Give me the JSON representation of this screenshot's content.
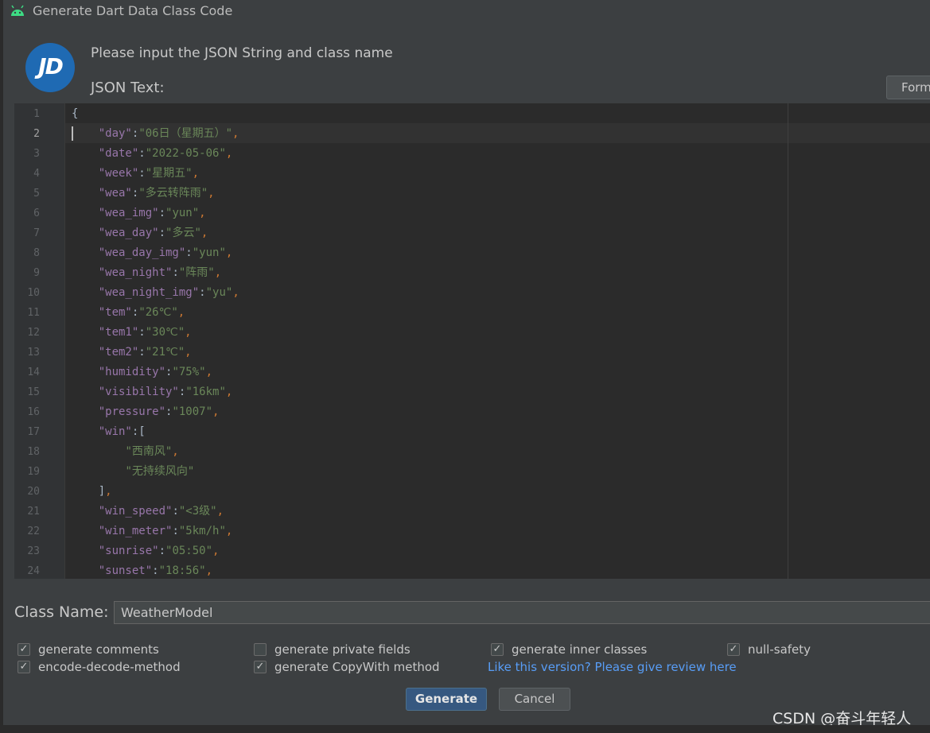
{
  "window": {
    "title": "Generate Dart Data Class Code",
    "icon": "android-icon"
  },
  "logo": {
    "text": "JD",
    "color": "#1f6ab3",
    "icon": "jd-logo"
  },
  "prompt": "Please input the JSON String and class name",
  "json_label": "JSON Text:",
  "format_button": "Form",
  "editor": {
    "current_line": 2,
    "lines": [
      {
        "n": "1",
        "parts": [
          [
            "b",
            "{"
          ]
        ]
      },
      {
        "n": "2",
        "parts": [
          [
            "b",
            "    "
          ],
          [
            "k",
            "\"day\""
          ],
          [
            "b",
            ":"
          ],
          [
            "s",
            "\"06日（星期五）\""
          ],
          [
            "p",
            ","
          ]
        ]
      },
      {
        "n": "3",
        "parts": [
          [
            "b",
            "    "
          ],
          [
            "k",
            "\"date\""
          ],
          [
            "b",
            ":"
          ],
          [
            "s",
            "\"2022-05-06\""
          ],
          [
            "p",
            ","
          ]
        ]
      },
      {
        "n": "4",
        "parts": [
          [
            "b",
            "    "
          ],
          [
            "k",
            "\"week\""
          ],
          [
            "b",
            ":"
          ],
          [
            "s",
            "\"星期五\""
          ],
          [
            "p",
            ","
          ]
        ]
      },
      {
        "n": "5",
        "parts": [
          [
            "b",
            "    "
          ],
          [
            "k",
            "\"wea\""
          ],
          [
            "b",
            ":"
          ],
          [
            "s",
            "\"多云转阵雨\""
          ],
          [
            "p",
            ","
          ]
        ]
      },
      {
        "n": "6",
        "parts": [
          [
            "b",
            "    "
          ],
          [
            "k",
            "\"wea_img\""
          ],
          [
            "b",
            ":"
          ],
          [
            "s",
            "\"yun\""
          ],
          [
            "p",
            ","
          ]
        ]
      },
      {
        "n": "7",
        "parts": [
          [
            "b",
            "    "
          ],
          [
            "k",
            "\"wea_day\""
          ],
          [
            "b",
            ":"
          ],
          [
            "s",
            "\"多云\""
          ],
          [
            "p",
            ","
          ]
        ]
      },
      {
        "n": "8",
        "parts": [
          [
            "b",
            "    "
          ],
          [
            "k",
            "\"wea_day_img\""
          ],
          [
            "b",
            ":"
          ],
          [
            "s",
            "\"yun\""
          ],
          [
            "p",
            ","
          ]
        ]
      },
      {
        "n": "9",
        "parts": [
          [
            "b",
            "    "
          ],
          [
            "k",
            "\"wea_night\""
          ],
          [
            "b",
            ":"
          ],
          [
            "s",
            "\"阵雨\""
          ],
          [
            "p",
            ","
          ]
        ]
      },
      {
        "n": "10",
        "parts": [
          [
            "b",
            "    "
          ],
          [
            "k",
            "\"wea_night_img\""
          ],
          [
            "b",
            ":"
          ],
          [
            "s",
            "\"yu\""
          ],
          [
            "p",
            ","
          ]
        ]
      },
      {
        "n": "11",
        "parts": [
          [
            "b",
            "    "
          ],
          [
            "k",
            "\"tem\""
          ],
          [
            "b",
            ":"
          ],
          [
            "s",
            "\"26℃\""
          ],
          [
            "p",
            ","
          ]
        ]
      },
      {
        "n": "12",
        "parts": [
          [
            "b",
            "    "
          ],
          [
            "k",
            "\"tem1\""
          ],
          [
            "b",
            ":"
          ],
          [
            "s",
            "\"30℃\""
          ],
          [
            "p",
            ","
          ]
        ]
      },
      {
        "n": "13",
        "parts": [
          [
            "b",
            "    "
          ],
          [
            "k",
            "\"tem2\""
          ],
          [
            "b",
            ":"
          ],
          [
            "s",
            "\"21℃\""
          ],
          [
            "p",
            ","
          ]
        ]
      },
      {
        "n": "14",
        "parts": [
          [
            "b",
            "    "
          ],
          [
            "k",
            "\"humidity\""
          ],
          [
            "b",
            ":"
          ],
          [
            "s",
            "\"75%\""
          ],
          [
            "p",
            ","
          ]
        ]
      },
      {
        "n": "15",
        "parts": [
          [
            "b",
            "    "
          ],
          [
            "k",
            "\"visibility\""
          ],
          [
            "b",
            ":"
          ],
          [
            "s",
            "\"16km\""
          ],
          [
            "p",
            ","
          ]
        ]
      },
      {
        "n": "16",
        "parts": [
          [
            "b",
            "    "
          ],
          [
            "k",
            "\"pressure\""
          ],
          [
            "b",
            ":"
          ],
          [
            "s",
            "\"1007\""
          ],
          [
            "p",
            ","
          ]
        ]
      },
      {
        "n": "17",
        "parts": [
          [
            "b",
            "    "
          ],
          [
            "k",
            "\"win\""
          ],
          [
            "b",
            ":["
          ]
        ]
      },
      {
        "n": "18",
        "parts": [
          [
            "b",
            "        "
          ],
          [
            "s",
            "\"西南风\""
          ],
          [
            "p",
            ","
          ]
        ]
      },
      {
        "n": "19",
        "parts": [
          [
            "b",
            "        "
          ],
          [
            "s",
            "\"无持续风向\""
          ]
        ]
      },
      {
        "n": "20",
        "parts": [
          [
            "b",
            "    ]"
          ],
          [
            "p",
            ","
          ]
        ]
      },
      {
        "n": "21",
        "parts": [
          [
            "b",
            "    "
          ],
          [
            "k",
            "\"win_speed\""
          ],
          [
            "b",
            ":"
          ],
          [
            "s",
            "\"<3级\""
          ],
          [
            "p",
            ","
          ]
        ]
      },
      {
        "n": "22",
        "parts": [
          [
            "b",
            "    "
          ],
          [
            "k",
            "\"win_meter\""
          ],
          [
            "b",
            ":"
          ],
          [
            "s",
            "\"5km/h\""
          ],
          [
            "p",
            ","
          ]
        ]
      },
      {
        "n": "23",
        "parts": [
          [
            "b",
            "    "
          ],
          [
            "k",
            "\"sunrise\""
          ],
          [
            "b",
            ":"
          ],
          [
            "s",
            "\"05:50\""
          ],
          [
            "p",
            ","
          ]
        ]
      },
      {
        "n": "24",
        "parts": [
          [
            "b",
            "    "
          ],
          [
            "k",
            "\"sunset\""
          ],
          [
            "b",
            ":"
          ],
          [
            "s",
            "\"18:56\""
          ],
          [
            "p",
            ","
          ]
        ]
      }
    ]
  },
  "class_name": {
    "label": "Class Name:",
    "value": "WeatherModel"
  },
  "options": [
    {
      "id": "generate-comments",
      "label": "generate comments",
      "checked": true
    },
    {
      "id": "generate-private-fields",
      "label": "generate private fields",
      "checked": false
    },
    {
      "id": "generate-inner-classes",
      "label": "generate inner classes",
      "checked": true
    },
    {
      "id": "null-safety",
      "label": "null-safety",
      "checked": true
    },
    {
      "id": "encode-decode-method",
      "label": "encode-decode-method",
      "checked": true
    },
    {
      "id": "generate-copywith-method",
      "label": "generate CopyWith method",
      "checked": true
    }
  ],
  "review_link": "Like this version? Please give review here",
  "buttons": {
    "generate": "Generate",
    "cancel": "Cancel"
  },
  "watermark": "CSDN @奋斗年轻人",
  "colors": {
    "background": "#3c3f41",
    "editor": "#2b2b2b",
    "key": "#9876aa",
    "string": "#6a8759",
    "punct": "#cc7832",
    "link": "#589df6",
    "primary_button": "#365880"
  }
}
